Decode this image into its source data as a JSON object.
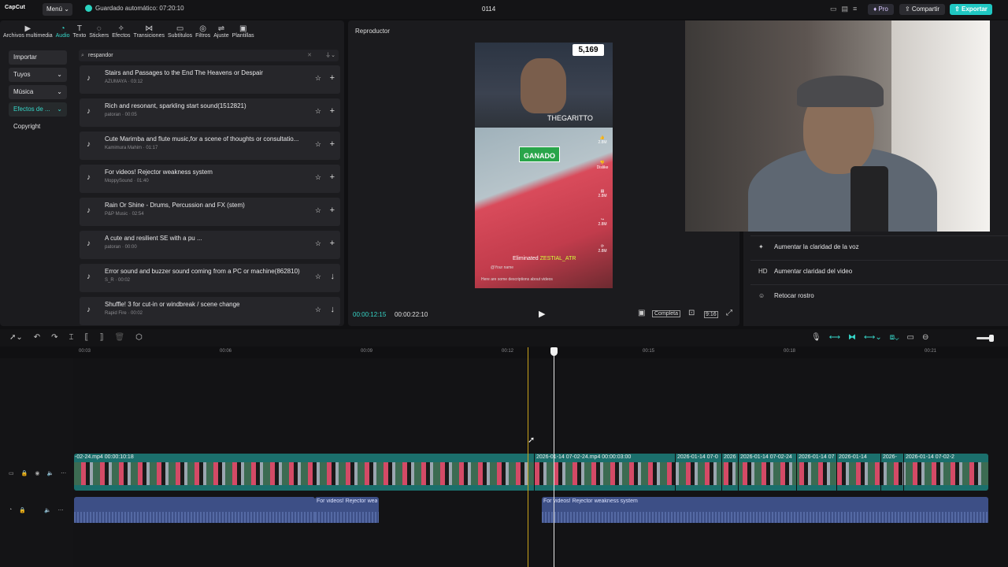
{
  "app": {
    "logo": "CapCut",
    "menu_label": "Menú",
    "autosave": "Guardado automático: 07:20:10",
    "project_title": "0114",
    "pro_label": "Pro",
    "share_label": "Compartir",
    "export_label": "Exportar",
    "accent": "#1fc7c2"
  },
  "tabs": [
    {
      "icon": "▶",
      "label": "Archivos multimedia"
    },
    {
      "icon": "◔",
      "label": "Audio"
    },
    {
      "icon": "T",
      "label": "Texto"
    },
    {
      "icon": "◌",
      "label": "Stickers"
    },
    {
      "icon": "✧",
      "label": "Efectos"
    },
    {
      "icon": "⋈",
      "label": "Transiciones"
    },
    {
      "icon": "▭",
      "label": "Subtítulos"
    },
    {
      "icon": "◎",
      "label": "Filtros"
    },
    {
      "icon": "⇌",
      "label": "Ajuste"
    },
    {
      "icon": "▣",
      "label": "Plantillas"
    }
  ],
  "side_nav": [
    {
      "label": "Importar",
      "chev": ""
    },
    {
      "label": "Tuyos",
      "chev": "⌄"
    },
    {
      "label": "Música",
      "chev": "⌄"
    },
    {
      "label": "Efectos de ...",
      "chev": "⌄"
    },
    {
      "label": "Copyright",
      "chev": ""
    }
  ],
  "search": {
    "value": "respandor"
  },
  "sounds": [
    {
      "title": "Stairs and Passages to the End The Heavens or Despair",
      "meta": "AZUMAYA · 03:12",
      "action": "+"
    },
    {
      "title": "Rich and resonant, sparkling start sound(1512821)",
      "meta": "patoran · 00:05",
      "action": "+"
    },
    {
      "title": "Cute Marimba and flute music,for a scene of thoughts or consultatio...",
      "meta": "Kamimura Mahim · 01:17",
      "action": "+"
    },
    {
      "title": "For videos! Rejector weakness system",
      "meta": "MoppySound · 01:40",
      "action": "+"
    },
    {
      "title": "Rain Or Shine - Drums, Percussion and FX (stem)",
      "meta": "P&P Music · 02:54",
      "action": "+"
    },
    {
      "title": "A cute and resilient SE with a pu ...",
      "meta": "patoran · 00:00",
      "action": "+"
    },
    {
      "title": "Error sound and buzzer sound coming from a PC or machine(862810)",
      "meta": "S_R · 00:02",
      "action": "↓"
    },
    {
      "title": "Shuffle! 3 for cut-in or windbreak / scene change",
      "meta": "Rapid Fire · 00:02",
      "action": "↓"
    }
  ],
  "player": {
    "title": "Reproductor",
    "current_time": "00:00:12:15",
    "total_time": "00:00:22:10",
    "ratio_label": "Completa",
    "zoom_label": "9:16",
    "preview": {
      "counter": "5,169",
      "channel": "THEGARITTO",
      "banner": "GANADO",
      "eliminated_prefix": "Eliminated",
      "eliminated_name": "ZESTIAL_ATR",
      "your_name": "@Your name",
      "description": "Here are some descriptions about videos",
      "stat1": "2.8M",
      "stat2": "Dislike",
      "stat3": "2.8M",
      "stat4": "2.8M",
      "stat5": "2.8M"
    }
  },
  "ai_tools": [
    {
      "icon": "✦",
      "label": "Aumentar la claridad de la voz"
    },
    {
      "icon": "HD",
      "label": "Aumentar claridad del video"
    },
    {
      "icon": "☺",
      "label": "Retocar rostro"
    }
  ],
  "ruler": [
    "00:03",
    "00:06",
    "00:09",
    "00:12",
    "00:15",
    "00:18",
    "00:21"
  ],
  "video_clips": [
    {
      "label": "-02-24.mp4   00:00:10:18"
    },
    {
      "label": "2026-01-14 07-02-24.mp4   00:00:03:00"
    },
    {
      "label": "2026-01-14 07-0"
    },
    {
      "label": "2026"
    },
    {
      "label": "2026-01-14 07-02-24"
    },
    {
      "label": "2026-01-14 07"
    },
    {
      "label": "2026-01-14"
    },
    {
      "label": "2026-"
    },
    {
      "label": "2026-01-14 07-02-2"
    }
  ],
  "audio_clips": [
    {
      "label": ""
    },
    {
      "label": "For videos! Rejector wea"
    },
    {
      "label": "For videos! Rejector weakness system"
    }
  ]
}
